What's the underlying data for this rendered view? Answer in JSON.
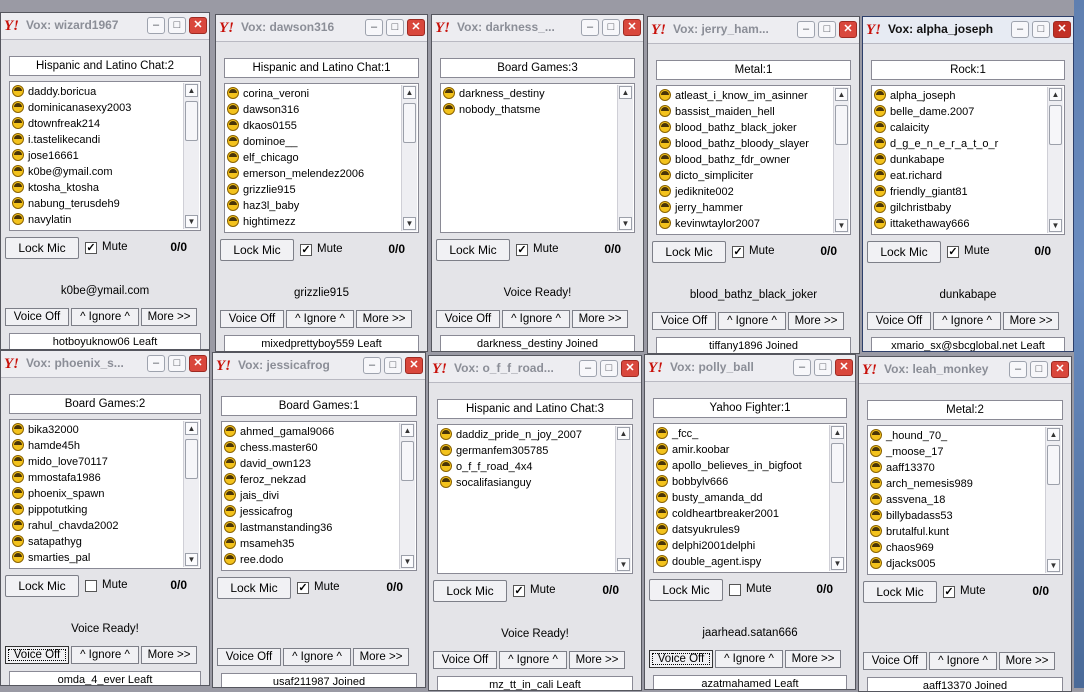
{
  "windows": [
    {
      "title": "Vox: wizard1967",
      "room": "Hispanic and Latino Chat:2",
      "users": [
        "daddy.boricua",
        "dominicanasexy2003",
        "dtownfreak214",
        "i.tastelikecandi",
        "jose16661",
        "k0be@ymail.com",
        "ktosha_ktosha",
        "nabung_terusdeh9",
        "navylatin"
      ],
      "lock_mic": "Lock Mic",
      "mute_label": "Mute",
      "muted": true,
      "counter": "0/0",
      "status": "k0be@ymail.com",
      "voice_btn": "Voice Off",
      "ignore_btn": "^ Ignore ^",
      "more_btn": "More >>",
      "log": "hotboyuknow06 Leaft",
      "min_icon": "–",
      "max_icon": "□",
      "close_icon": "✕"
    },
    {
      "title": "Vox: dawson316",
      "room": "Hispanic and Latino Chat:1",
      "users": [
        "corina_veroni",
        "dawson316",
        "dkaos0155",
        "dominoe__",
        "elf_chicago",
        "emerson_melendez2006",
        "grizzlie915",
        "haz3l_baby",
        "hightimezz"
      ],
      "lock_mic": "Lock Mic",
      "mute_label": "Mute",
      "muted": true,
      "counter": "0/0",
      "status": "grizzlie915",
      "voice_btn": "Voice Off",
      "ignore_btn": "^ Ignore ^",
      "more_btn": "More >>",
      "log": "mixedprettyboy559 Leaft",
      "min_icon": "–",
      "max_icon": "□",
      "close_icon": "✕"
    },
    {
      "title": "Vox: darkness_...",
      "room": "Board Games:3",
      "users": [
        "darkness_destiny",
        "nobody_thatsme"
      ],
      "lock_mic": "Lock Mic",
      "mute_label": "Mute",
      "muted": true,
      "counter": "0/0",
      "status": "Voice Ready!",
      "voice_btn": "Voice Off",
      "ignore_btn": "^ Ignore ^",
      "more_btn": "More >>",
      "log": "darkness_destiny Joined",
      "min_icon": "–",
      "max_icon": "□",
      "close_icon": "✕"
    },
    {
      "title": "Vox: jerry_ham...",
      "room": "Metal:1",
      "users": [
        "atleast_i_know_im_asinner",
        "bassist_maiden_hell",
        "blood_bathz_black_joker",
        "blood_bathz_bloody_slayer",
        "blood_bathz_fdr_owner",
        "dicto_simpliciter",
        "jediknite002",
        "jerry_hammer",
        "kevinwtaylor2007"
      ],
      "lock_mic": "Lock Mic",
      "mute_label": "Mute",
      "muted": true,
      "counter": "0/0",
      "status": "blood_bathz_black_joker",
      "voice_btn": "Voice Off",
      "ignore_btn": "^ Ignore ^",
      "more_btn": "More >>",
      "log": "tiffany1896 Joined",
      "min_icon": "–",
      "max_icon": "□",
      "close_icon": "✕"
    },
    {
      "title": "Vox: alpha_joseph",
      "room": "Rock:1",
      "users": [
        "alpha_joseph",
        "belle_dame.2007",
        "calaicity",
        "d_g_e_n_e_r_a_t_o_r",
        "dunkabape",
        "eat.richard",
        "friendly_giant81",
        "gilchristbaby",
        "ittakethaway666"
      ],
      "lock_mic": "Lock Mic",
      "mute_label": "Mute",
      "muted": true,
      "counter": "0/0",
      "status": "dunkabape",
      "voice_btn": "Voice Off",
      "ignore_btn": "^ Ignore ^",
      "more_btn": "More >>",
      "log": "xmario_sx@sbcglobal.net Leaft",
      "min_icon": "–",
      "max_icon": "□",
      "close_icon": "✕"
    },
    {
      "title": "Vox: phoenix_s...",
      "room": "Board Games:2",
      "users": [
        "bika32000",
        "hamde45h",
        "mido_love70117",
        "mmostafa1986",
        "phoenix_spawn",
        "pippotutking",
        "rahul_chavda2002",
        "satapathyg",
        "smarties_pal"
      ],
      "lock_mic": "Lock Mic",
      "mute_label": "Mute",
      "muted": false,
      "counter": "0/0",
      "status": "Voice Ready!",
      "voice_btn": "Voice Off",
      "ignore_btn": "^ Ignore ^",
      "more_btn": "More >>",
      "log": "omda_4_ever Leaft",
      "min_icon": "–",
      "max_icon": "□",
      "close_icon": "✕"
    },
    {
      "title": "Vox: jessicafrog",
      "room": "Board Games:1",
      "users": [
        "ahmed_gamal9066",
        "chess.master60",
        "david_own123",
        "feroz_nekzad",
        "jais_divi",
        "jessicafrog",
        "lastmanstanding36",
        "msameh35",
        "ree.dodo"
      ],
      "lock_mic": "Lock Mic",
      "mute_label": "Mute",
      "muted": true,
      "counter": "0/0",
      "status": "",
      "voice_btn": "Voice Off",
      "ignore_btn": "^ Ignore ^",
      "more_btn": "More >>",
      "log": "usaf211987 Joined",
      "min_icon": "–",
      "max_icon": "□",
      "close_icon": "✕"
    },
    {
      "title": "Vox: o_f_f_road...",
      "room": "Hispanic and Latino Chat:3",
      "users": [
        "daddiz_pride_n_joy_2007",
        "germanfem305785",
        "o_f_f_road_4x4",
        "socalifasianguy"
      ],
      "lock_mic": "Lock Mic",
      "mute_label": "Mute",
      "muted": true,
      "counter": "0/0",
      "status": "Voice Ready!",
      "voice_btn": "Voice Off",
      "ignore_btn": "^ Ignore ^",
      "more_btn": "More >>",
      "log": "mz_tt_in_cali Leaft",
      "min_icon": "–",
      "max_icon": "□",
      "close_icon": "✕"
    },
    {
      "title": "Vox: polly_ball",
      "room": "Yahoo Fighter:1",
      "users": [
        "_fcc_",
        "amir.koobar",
        "apollo_believes_in_bigfoot",
        "bobbylv666",
        "busty_amanda_dd",
        "coldheartbreaker2001",
        "datsyukrules9",
        "delphi2001delphi",
        "double_agent.ispy"
      ],
      "lock_mic": "Lock Mic",
      "mute_label": "Mute",
      "muted": false,
      "counter": "0/0",
      "status": "jaarhead.satan666",
      "voice_btn": "Voice Off",
      "ignore_btn": "^ Ignore ^",
      "more_btn": "More >>",
      "log": "azatmahamed Leaft",
      "min_icon": "–",
      "max_icon": "□",
      "close_icon": "✕"
    },
    {
      "title": "Vox: leah_monkey",
      "room": "Metal:2",
      "users": [
        "_hound_70_",
        "_moose_17",
        "aaff13370",
        "arch_nemesis989",
        "assvena_18",
        "billybadass53",
        "brutalful.kunt",
        "chaos969",
        "djacks005"
      ],
      "lock_mic": "Lock Mic",
      "mute_label": "Mute",
      "muted": true,
      "counter": "0/0",
      "status": "",
      "voice_btn": "Voice Off",
      "ignore_btn": "^ Ignore ^",
      "more_btn": "More >>",
      "log": "aaff13370 Joined",
      "min_icon": "–",
      "max_icon": "□",
      "close_icon": "✕"
    }
  ],
  "colors": {
    "title_active": "#111111",
    "title_inactive": "#8b8e97",
    "close_button": "#d9473c",
    "desktop": "#9a9aa4"
  },
  "icons": {
    "app_logo": "yahoo-logo-icon",
    "user": "smiley-user-icon",
    "scroll_up": "scroll-up-arrow-icon",
    "scroll_down": "scroll-down-arrow-icon"
  }
}
